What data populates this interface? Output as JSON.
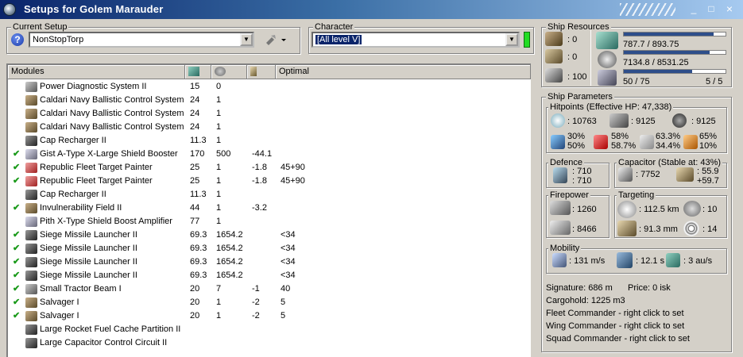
{
  "window": {
    "title": "Setups for Golem Marauder",
    "min": "_",
    "max": "□",
    "close": "×"
  },
  "current_setup": {
    "label": "Current Setup",
    "value": "NonStopTorp"
  },
  "character": {
    "label": "Character",
    "value": "[All level V]"
  },
  "modules": {
    "header": {
      "name": "Modules",
      "optimal": "Optimal"
    },
    "rows": [
      {
        "checked": false,
        "icon": "gray",
        "name": "Power Diagnostic System II",
        "c1": "15",
        "c2": "0",
        "c3": "",
        "c4": ""
      },
      {
        "checked": false,
        "icon": "brown",
        "name": "Caldari Navy Ballistic Control System",
        "c1": "24",
        "c2": "1",
        "c3": "",
        "c4": ""
      },
      {
        "checked": false,
        "icon": "brown",
        "name": "Caldari Navy Ballistic Control System",
        "c1": "24",
        "c2": "1",
        "c3": "",
        "c4": ""
      },
      {
        "checked": false,
        "icon": "brown",
        "name": "Caldari Navy Ballistic Control System",
        "c1": "24",
        "c2": "1",
        "c3": "",
        "c4": ""
      },
      {
        "checked": false,
        "icon": "dark",
        "name": "Cap Recharger II",
        "c1": "11.3",
        "c2": "1",
        "c3": "",
        "c4": ""
      },
      {
        "checked": true,
        "icon": "blue",
        "name": "Gist A-Type X-Large Shield Booster",
        "c1": "170",
        "c2": "500",
        "c3": "-44.1",
        "c4": ""
      },
      {
        "checked": true,
        "icon": "red",
        "name": "Republic Fleet Target Painter",
        "c1": "25",
        "c2": "1",
        "c3": "-1.8",
        "c4": "45+90"
      },
      {
        "checked": true,
        "icon": "red",
        "name": "Republic Fleet Target Painter",
        "c1": "25",
        "c2": "1",
        "c3": "-1.8",
        "c4": "45+90"
      },
      {
        "checked": false,
        "icon": "dark",
        "name": "Cap Recharger II",
        "c1": "11.3",
        "c2": "1",
        "c3": "",
        "c4": ""
      },
      {
        "checked": true,
        "icon": "brown",
        "name": "Invulnerability Field II",
        "c1": "44",
        "c2": "1",
        "c3": "-3.2",
        "c4": ""
      },
      {
        "checked": false,
        "icon": "blue",
        "name": "Pith X-Type Shield Boost Amplifier",
        "c1": "77",
        "c2": "1",
        "c3": "",
        "c4": ""
      },
      {
        "checked": true,
        "icon": "dark",
        "name": "Siege Missile Launcher II",
        "c1": "69.3",
        "c2": "1654.2",
        "c3": "",
        "c4": "<34"
      },
      {
        "checked": true,
        "icon": "dark",
        "name": "Siege Missile Launcher II",
        "c1": "69.3",
        "c2": "1654.2",
        "c3": "",
        "c4": "<34"
      },
      {
        "checked": true,
        "icon": "dark",
        "name": "Siege Missile Launcher II",
        "c1": "69.3",
        "c2": "1654.2",
        "c3": "",
        "c4": "<34"
      },
      {
        "checked": true,
        "icon": "dark",
        "name": "Siege Missile Launcher II",
        "c1": "69.3",
        "c2": "1654.2",
        "c3": "",
        "c4": "<34"
      },
      {
        "checked": true,
        "icon": "gray",
        "name": "Small Tractor Beam I",
        "c1": "20",
        "c2": "7",
        "c3": "-1",
        "c4": "40"
      },
      {
        "checked": true,
        "icon": "brown",
        "name": "Salvager I",
        "c1": "20",
        "c2": "1",
        "c3": "-2",
        "c4": "5"
      },
      {
        "checked": true,
        "icon": "brown",
        "name": "Salvager I",
        "c1": "20",
        "c2": "1",
        "c3": "-2",
        "c4": "5"
      },
      {
        "checked": false,
        "icon": "dark",
        "name": "Large Rocket Fuel Cache Partition II",
        "c1": "",
        "c2": "",
        "c3": "",
        "c4": ""
      },
      {
        "checked": false,
        "icon": "dark",
        "name": "Large Capacitor Control Circuit II",
        "c1": "",
        "c2": "",
        "c3": "",
        "c4": ""
      }
    ]
  },
  "resources": {
    "label": "Ship Resources",
    "hardpoints": {
      "turret": ": 0",
      "launcher": ": 0",
      "calibration": ": 100"
    },
    "cpu": "787.7 / 893.75",
    "cpu_fill": 0.88,
    "powergrid": "7134.8 / 8531.25",
    "powergrid_fill": 0.84,
    "drone_bay": "50 / 75",
    "drone_fill": 0.67,
    "drones": "5 / 5"
  },
  "params": {
    "label": "Ship Parameters",
    "hitpoints": {
      "label": "Hitpoints (Effective HP: 47,338)",
      "shield": ": 10763",
      "armor": ": 9125",
      "structure": ": 9125",
      "res1a": "30%",
      "res1b": "50%",
      "res2a": "58%",
      "res2b": "58.7%",
      "res3a": "63.3%",
      "res3b": "34.4%",
      "res4a": "65%",
      "res4b": "10%"
    },
    "defence": {
      "label": "Defence",
      "a": ": 710",
      "b": ": 710"
    },
    "capacitor": {
      "label": "Capacitor (Stable at: 43%)",
      "amount": ": 7752",
      "a": ": 55.9",
      "b": "+59.7"
    },
    "firepower": {
      "label": "Firepower",
      "a": ": 1260",
      "b": ": 8466"
    },
    "targeting": {
      "label": "Targeting",
      "range": ": 112.5 km",
      "targets": ": 10",
      "scan": ": 91.3 mm",
      "sensor": ": 14"
    },
    "mobility": {
      "label": "Mobility",
      "speed": ": 131 m/s",
      "align": ": 12.1 s",
      "warp": ": 3 au/s"
    },
    "signature": "Signature: 686 m",
    "price": "Price: 0 isk",
    "cargohold": "Cargohold: 1225 m3",
    "fleet": "Fleet Commander - right click to set",
    "wing": "Wing Commander - right click to set",
    "squad": "Squad Commander - right click to set"
  },
  "colors": {
    "title_start": "#0a246a",
    "title_end": "#a6caf0",
    "check": "#1a9a1a",
    "char_ok": "#22dd22",
    "bar_fill": "#2e4e8a"
  }
}
